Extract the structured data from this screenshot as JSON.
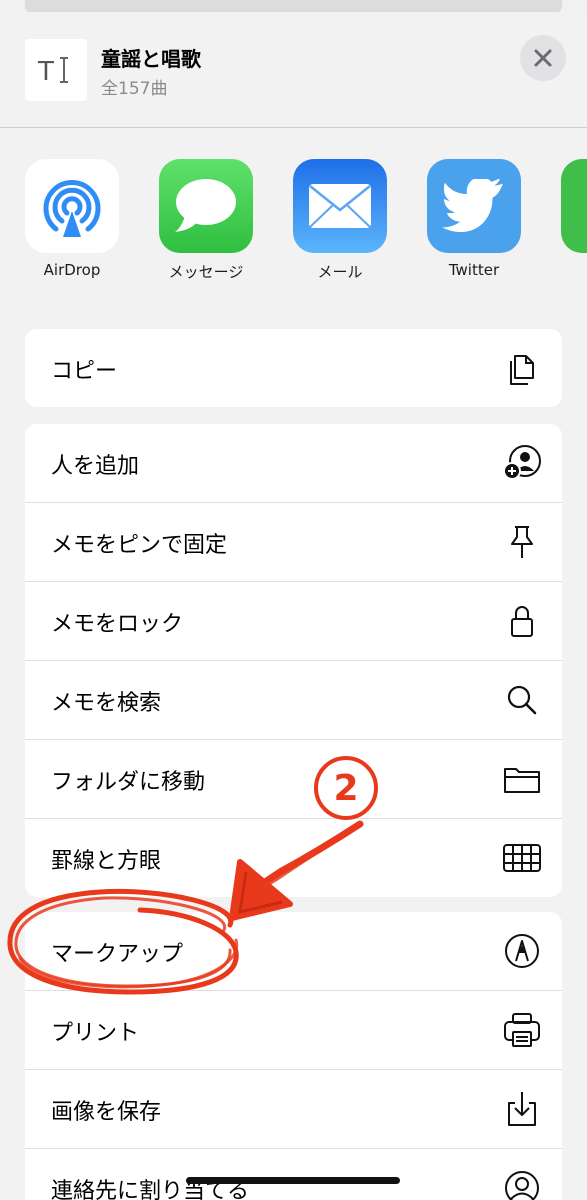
{
  "header": {
    "title": "童謡と唱歌",
    "subtitle": "全157曲",
    "doc_icon": "text-cursor-icon",
    "close_icon": "close-icon"
  },
  "apps": [
    {
      "label": "AirDrop",
      "icon": "airdrop-icon",
      "color": "#ffffff"
    },
    {
      "label": "メッセージ",
      "icon": "messages-icon",
      "color": "#3ec84c"
    },
    {
      "label": "メール",
      "icon": "mail-icon",
      "color": "#2f86f5"
    },
    {
      "label": "Twitter",
      "icon": "twitter-icon",
      "color": "#4aa1ec"
    }
  ],
  "group1": [
    {
      "label": "コピー",
      "icon": "copy-icon"
    }
  ],
  "group2": [
    {
      "label": "人を追加",
      "icon": "add-person-icon"
    },
    {
      "label": "メモをピンで固定",
      "icon": "pin-icon"
    },
    {
      "label": "メモをロック",
      "icon": "lock-icon"
    },
    {
      "label": "メモを検索",
      "icon": "search-icon"
    },
    {
      "label": "フォルダに移動",
      "icon": "folder-icon"
    },
    {
      "label": "罫線と方眼",
      "icon": "grid-icon"
    }
  ],
  "group3": [
    {
      "label": "マークアップ",
      "icon": "markup-icon"
    },
    {
      "label": "プリント",
      "icon": "printer-icon"
    },
    {
      "label": "画像を保存",
      "icon": "save-image-icon"
    },
    {
      "label": "連絡先に割り当てる",
      "icon": "contact-icon"
    }
  ],
  "annotation": {
    "number": "②",
    "color": "#e8391d"
  }
}
